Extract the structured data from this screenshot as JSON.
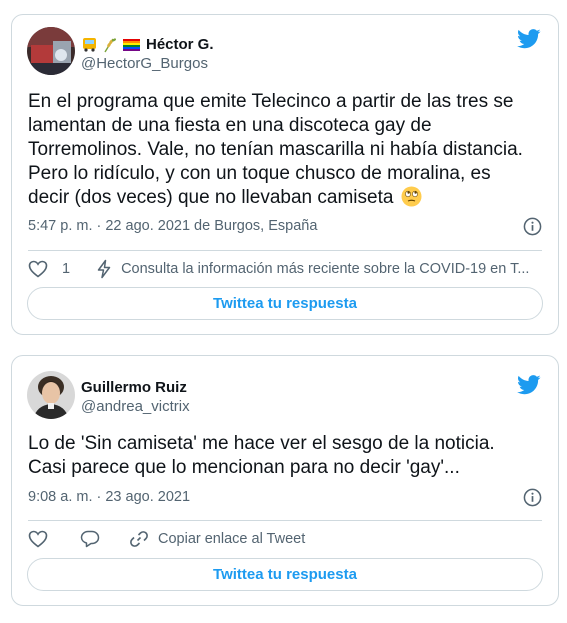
{
  "tweets": [
    {
      "author": {
        "name": "Héctor G.",
        "handle": "@HectorG_Burgos",
        "emoji_icons": [
          "bus-emoji-icon",
          "wheat-emoji-icon",
          "rainbow-flag-emoji-icon"
        ]
      },
      "text_lines": [
        "En el programa que emite Telecinco a partir de las tres se",
        "lamentan de una fiesta en una discoteca gay de",
        "Torremolinos. Vale, no tenían mascarilla ni había distancia.",
        "Pero lo ridículo, y con un toque chusco de moralina, es",
        "decir (dos veces) que no llevaban camiseta"
      ],
      "text_emoji": "face-with-rolling-eyes-emoji-icon",
      "timestamp": "5:47 p. m. · 22 ago. 2021 de Burgos, España",
      "likes": "1",
      "covid_notice": "Consulta la información más reciente sobre la COVID-19 en T...",
      "reply_label": "Twittea tu respuesta"
    },
    {
      "author": {
        "name": "Guillermo Ruiz",
        "handle": "@andrea_victrix"
      },
      "text_lines": [
        "Lo de 'Sin camiseta' me hace ver el sesgo de la noticia.",
        "Casi parece que lo mencionan para no decir 'gay'..."
      ],
      "timestamp": "9:08 a. m. · 23 ago. 2021",
      "copy_link_label": "Copiar enlace al Tweet",
      "reply_label": "Twittea tu respuesta"
    }
  ],
  "colors": {
    "twitter_blue": "#1d9bf0",
    "text_primary": "#0f1419",
    "text_secondary": "#536471",
    "border": "#cfd9de"
  }
}
